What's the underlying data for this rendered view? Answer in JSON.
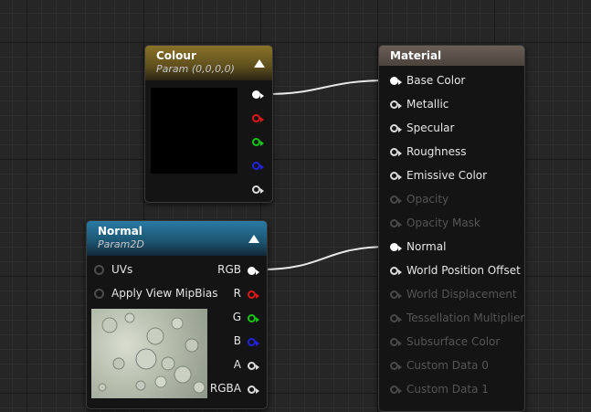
{
  "colour_node": {
    "title": "Colour",
    "subtitle": "Param (0,0,0,0)",
    "header_color": "#7a6520"
  },
  "normal_node": {
    "title": "Normal",
    "subtitle": "Param2D",
    "header_color": "#1f5a7a",
    "inputs": [
      "UVs",
      "Apply View MipBias"
    ],
    "outputs": [
      "RGB",
      "R",
      "G",
      "B",
      "A",
      "RGBA"
    ]
  },
  "material_node": {
    "title": "Material",
    "header_color": "#5a4f47",
    "inputs": [
      {
        "label": "Base Color",
        "enabled": true,
        "connected": true
      },
      {
        "label": "Metallic",
        "enabled": true,
        "connected": false
      },
      {
        "label": "Specular",
        "enabled": true,
        "connected": false
      },
      {
        "label": "Roughness",
        "enabled": true,
        "connected": false
      },
      {
        "label": "Emissive Color",
        "enabled": true,
        "connected": false
      },
      {
        "label": "Opacity",
        "enabled": false,
        "connected": false
      },
      {
        "label": "Opacity Mask",
        "enabled": false,
        "connected": false
      },
      {
        "label": "Normal",
        "enabled": true,
        "connected": true
      },
      {
        "label": "World Position Offset",
        "enabled": true,
        "connected": false
      },
      {
        "label": "World Displacement",
        "enabled": false,
        "connected": false
      },
      {
        "label": "Tessellation Multiplier",
        "enabled": false,
        "connected": false
      },
      {
        "label": "Subsurface Color",
        "enabled": false,
        "connected": false
      },
      {
        "label": "Custom Data 0",
        "enabled": false,
        "connected": false
      },
      {
        "label": "Custom Data 1",
        "enabled": false,
        "connected": false
      }
    ]
  },
  "wire_color": "#e8e8e8"
}
